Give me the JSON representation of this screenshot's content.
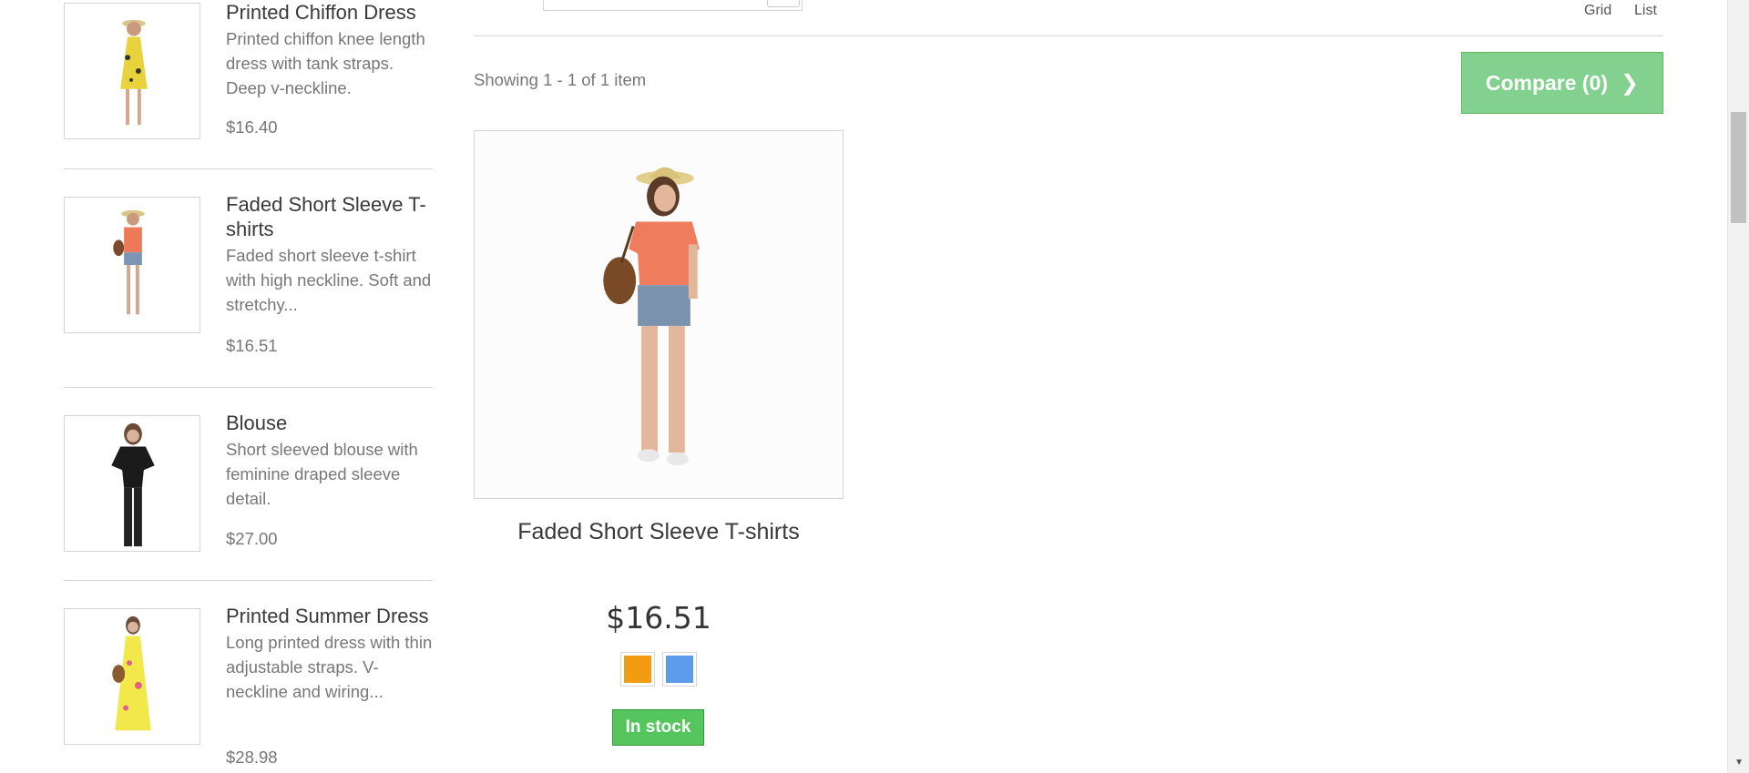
{
  "sidebar": {
    "items": [
      {
        "name": "Printed Chiffon Dress",
        "description": "Printed chiffon knee length dress with tank straps. Deep v-neckline.",
        "price": "$16.40",
        "image_icon": "dress-yellow-image"
      },
      {
        "name": "Faded Short Sleeve T-shirts",
        "description": "Faded short sleeve t-shirt with high neckline. Soft and stretchy...",
        "price": "$16.51",
        "image_icon": "tshirt-orange-image"
      },
      {
        "name": "Blouse",
        "description": "Short sleeved blouse with feminine draped sleeve detail.",
        "price": "$27.00",
        "image_icon": "blouse-black-image"
      },
      {
        "name": "Printed Summer Dress",
        "description": "Long printed dress with thin adjustable straps. V-neckline and wiring...",
        "price": "$28.98",
        "image_icon": "summer-dress-image"
      }
    ]
  },
  "toolbar": {
    "grid_label": "Grid",
    "list_label": "List",
    "showing_text": "Showing 1 - 1 of 1 item",
    "compare_label": "Compare (0)"
  },
  "product": {
    "name": "Faded Short Sleeve T-shirts",
    "price": "$16.51",
    "colors": [
      "#f39c11",
      "#5d9cec"
    ],
    "availability": "In stock"
  },
  "colors": {
    "compare_bg": "#82d18f",
    "stock_bg": "#55c65e",
    "border": "#d6d4d4"
  }
}
